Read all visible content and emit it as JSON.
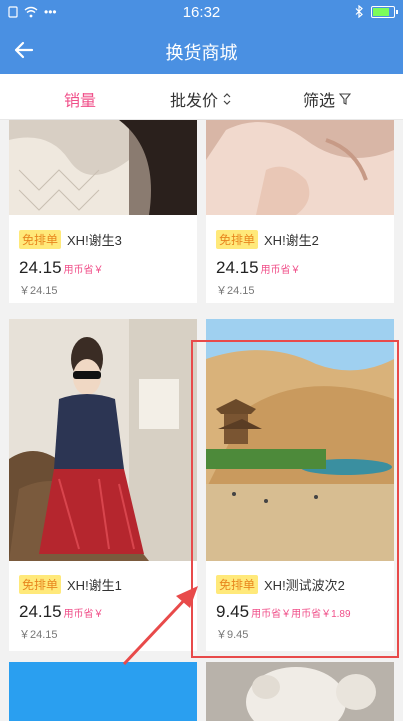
{
  "status": {
    "time": "16:32",
    "left_icons": [
      "sim-icon",
      "wifi-icon",
      "more-dots-icon"
    ],
    "right_icons": [
      "bluetooth-icon",
      "battery-icon"
    ],
    "battery_level": 0.85
  },
  "nav": {
    "title": "换货商城",
    "back_icon": "arrow-left-icon"
  },
  "sort": {
    "sales_label": "销量",
    "price_label": "批发价",
    "filter_label": "筛选"
  },
  "products": [
    {
      "badge": "免排单",
      "name": "XH!谢生3",
      "price": "24.15",
      "note": "用币省￥",
      "sub": "￥24.15"
    },
    {
      "badge": "免排单",
      "name": "XH!谢生2",
      "price": "24.15",
      "note": "用币省￥",
      "sub": "￥24.15"
    },
    {
      "badge": "免排单",
      "name": "XH!谢生1",
      "price": "24.15",
      "note": "用币省￥",
      "sub": "￥24.15"
    },
    {
      "badge": "免排单",
      "name": "XH!测试波次2",
      "price": "9.45",
      "note": "用币省￥用币省￥1.89",
      "sub": "￥9.45"
    }
  ],
  "colors": {
    "primary": "#4a90e2",
    "accent_pink": "#f0508a",
    "badge_bg": "#ffe97a",
    "annotation_red": "#e84a4a"
  }
}
